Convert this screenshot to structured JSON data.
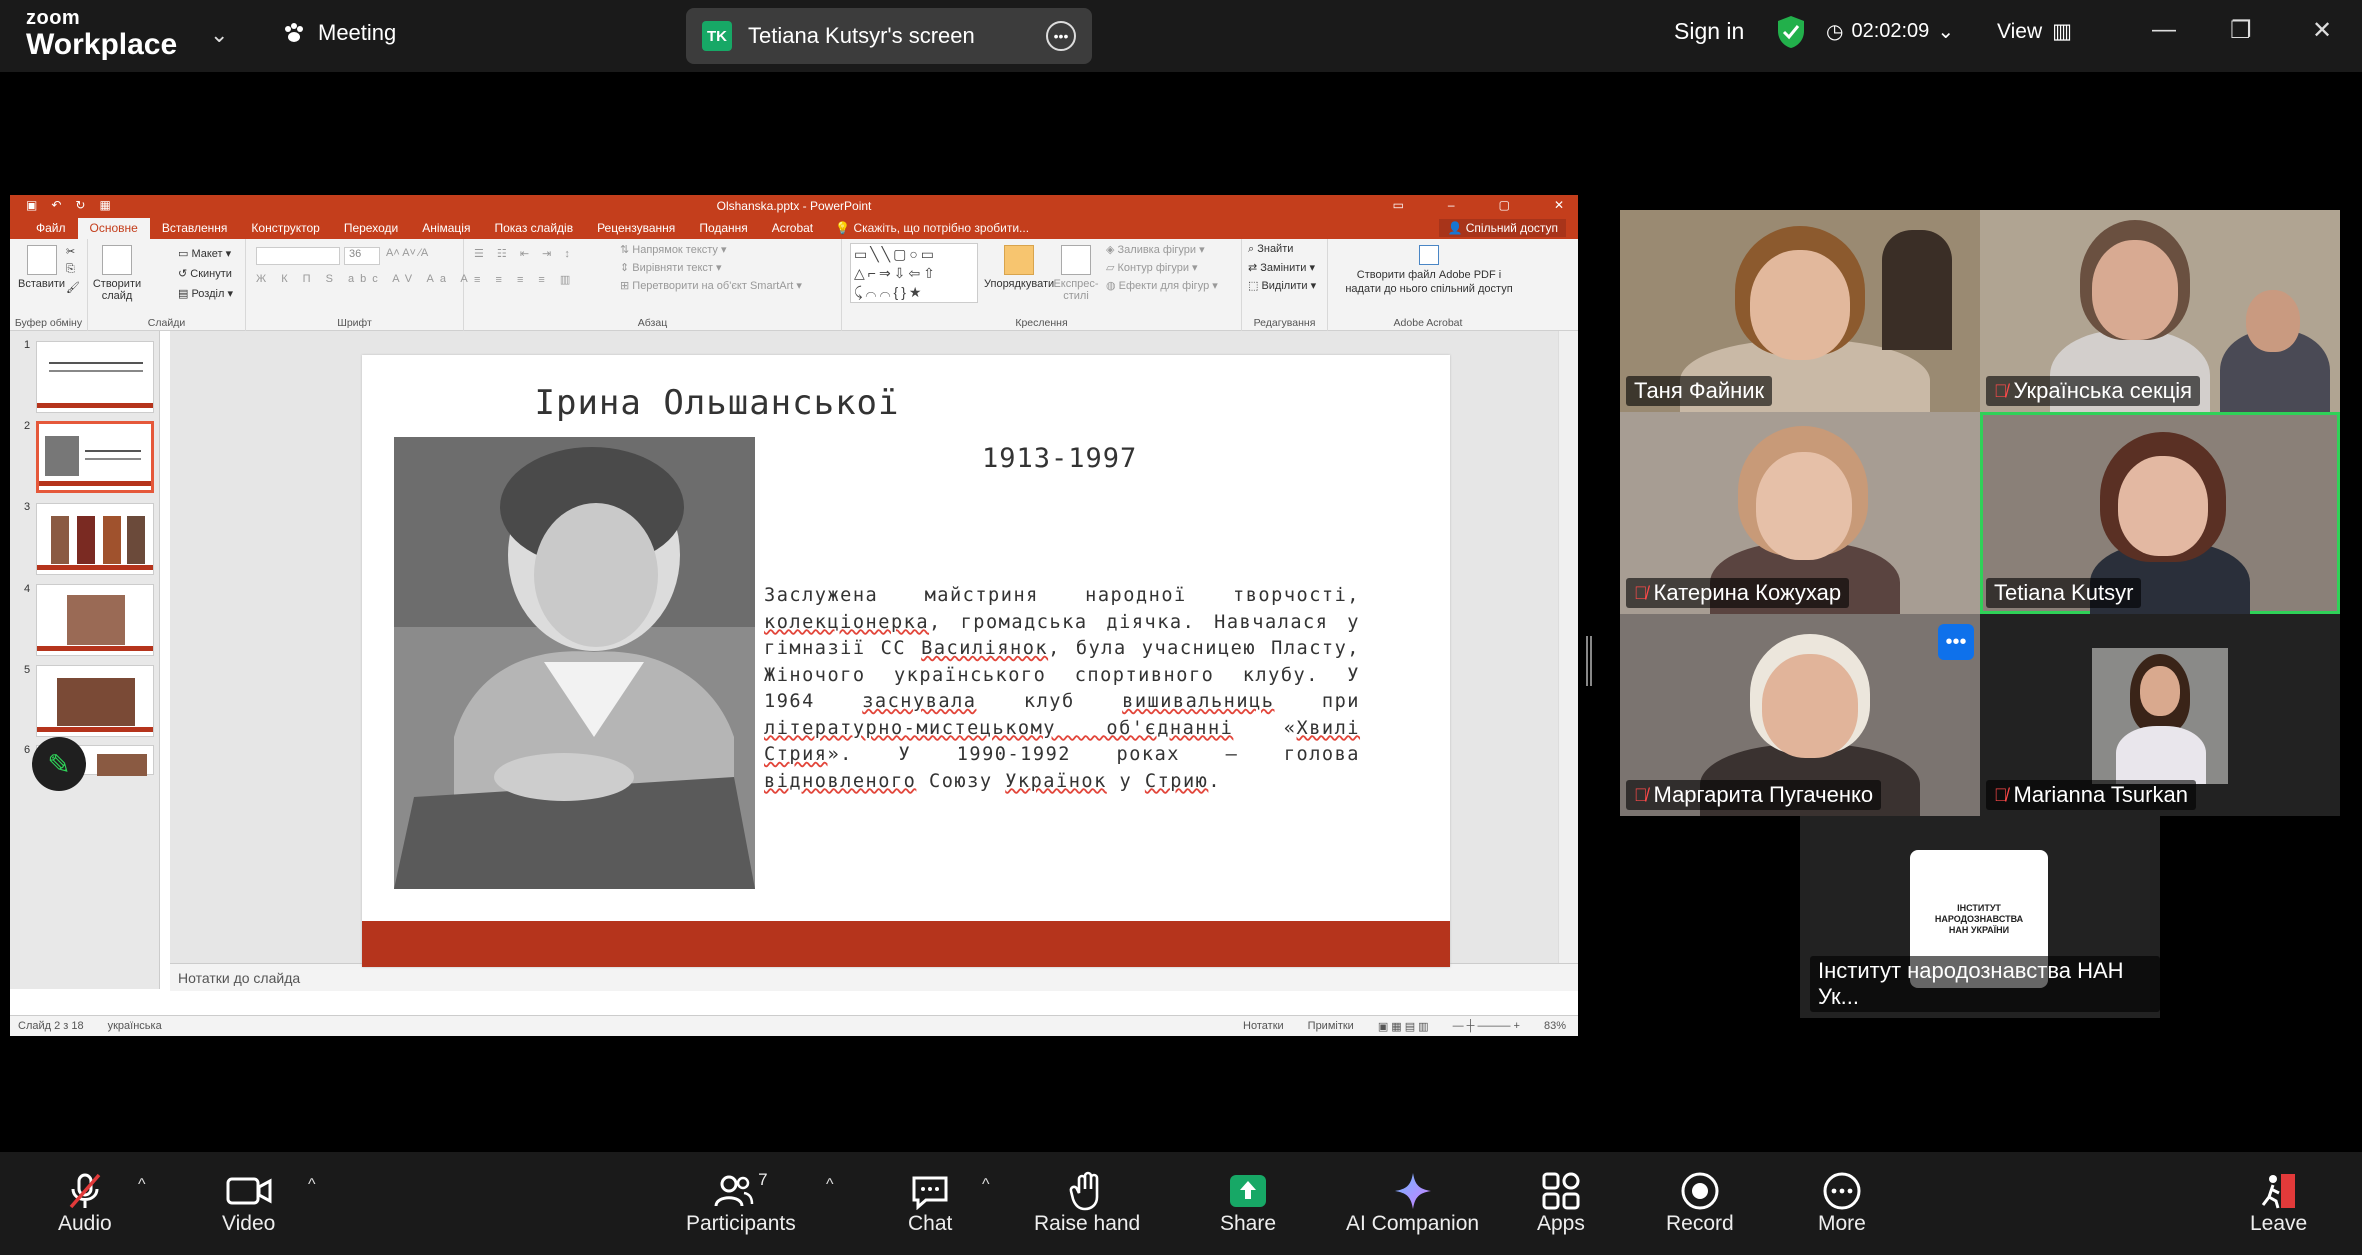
{
  "topbar": {
    "logo_line1": "zoom",
    "logo_line2": "Workplace",
    "meeting_label": "Meeting",
    "share_initials": "TK",
    "share_title": "Tetiana Kutsyr's screen",
    "sign_in": "Sign in",
    "timer": "02:02:09",
    "view_label": "View"
  },
  "powerpoint": {
    "window_title": "Olshanska.pptx - PowerPoint",
    "tabs": [
      "Файл",
      "Основне",
      "Вставлення",
      "Конструктор",
      "Переходи",
      "Анімація",
      "Показ слайдів",
      "Рецензування",
      "Подання",
      "Acrobat"
    ],
    "tell_me": "Скажіть, що потрібно зробити...",
    "shared_access": "Спільний доступ",
    "ribbon": {
      "paste": "Вставити",
      "clipboard_group": "Буфер обміну",
      "new_slide": "Створити слайд",
      "layout": "Макет",
      "reset": "Скинути",
      "section": "Розділ",
      "slides_group": "Слайди",
      "font_group": "Шрифт",
      "font_size": "36",
      "text_direction": "Напрямок тексту",
      "align_text": "Вирівняти текст",
      "convert_smartart": "Перетворити на об'єкт SmartArt",
      "paragraph_group": "Абзац",
      "arrange": "Упорядкувати",
      "quick_styles": "Експрес-стилі",
      "shape_fill": "Заливка фігури",
      "shape_outline": "Контур фігури",
      "shape_effects": "Ефекти для фігур",
      "drawing_group": "Креслення",
      "find": "Знайти",
      "replace": "Замінити",
      "select": "Виділити",
      "editing_group": "Редагування",
      "acrobat_btn": "Створити файл Adobe PDF і надати до нього спільний доступ",
      "acrobat_group": "Adobe Acrobat"
    },
    "thumbnails": [
      {
        "num": "1"
      },
      {
        "num": "2"
      },
      {
        "num": "3"
      },
      {
        "num": "4"
      },
      {
        "num": "5"
      },
      {
        "num": "6"
      }
    ],
    "slide": {
      "title": "Ірина Ольшанської",
      "dates": "1913-1997",
      "body_parts": [
        "Заслужена майстриня народної творчості, ",
        "колекціонерка",
        ", громадська діячка. Навчалася у гімназії СС ",
        "Василіянок",
        ", була учасницею Пласту, Жіночого українського спортивного клубу. У 1964 ",
        "заснувала",
        " клуб ",
        "вишивальниць",
        " при ",
        "літературно-мистецькому об'єднанні",
        " «",
        "Хвилі Стрия",
        "». У 1990-1992 роках — голова ",
        "відновленого",
        " Союзу ",
        "Українок",
        " у ",
        "Стрию",
        "."
      ]
    },
    "notes_placeholder": "Нотатки до слайда",
    "status": {
      "slide_counter": "Слайд 2 з 18",
      "language": "українська",
      "notes_btn": "Нотатки",
      "comments_btn": "Примітки",
      "zoom_level": "83%"
    }
  },
  "participants": [
    {
      "name": "Таня Файник",
      "muted": false
    },
    {
      "name": "Українська секція",
      "muted": true
    },
    {
      "name": "Катерина Кожухар",
      "muted": true
    },
    {
      "name": "Tetiana Kutsyr",
      "muted": false,
      "active": true
    },
    {
      "name": "Маргарита Пугаченко",
      "muted": true
    },
    {
      "name": "Marianna Tsurkan",
      "muted": true
    },
    {
      "name": "Інститут народознавства НАН Ук..."
    }
  ],
  "institute_logo_text": "ІНСТИТУТ НАРОДОЗНАВСТВА НАН УКРАЇНИ",
  "toolbar": {
    "audio": "Audio",
    "video": "Video",
    "participants": "Participants",
    "participants_count": "7",
    "chat": "Chat",
    "raise_hand": "Raise hand",
    "share": "Share",
    "ai_companion": "AI Companion",
    "apps": "Apps",
    "record": "Record",
    "more": "More",
    "leave": "Leave"
  },
  "colors": {
    "ppt_accent": "#c43e1c",
    "active_speaker": "#2fd158",
    "share_green": "#17a866",
    "zoom_blue": "#0e71eb",
    "leave_red": "#e23a3a"
  }
}
